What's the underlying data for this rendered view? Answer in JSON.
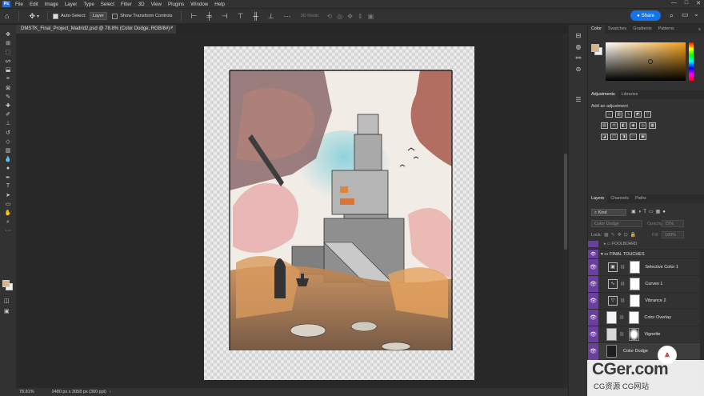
{
  "app": {
    "logo": "Ps",
    "menu": [
      "File",
      "Edit",
      "Image",
      "Layer",
      "Type",
      "Select",
      "Filter",
      "3D",
      "View",
      "Plugins",
      "Window",
      "Help"
    ],
    "window_controls": [
      "—",
      "□",
      "✕"
    ]
  },
  "options_bar": {
    "auto_select_label": "Auto-Select:",
    "auto_select_value": "Layer",
    "show_transform_label": "Show Transform Controls",
    "mode_3d_label": "3D Mode:",
    "share_label": "Share"
  },
  "document": {
    "tab_title": "DMSTK_Final_Project_Madrid2.psd @ 78.8% (Color Dodge, RGB/8#) *",
    "close_glyph": "×"
  },
  "status_bar": {
    "zoom": "78.81%",
    "doc_info": "2480 px x 3058 px (300 ppi)",
    "arrow": "›"
  },
  "color_panel": {
    "tabs": [
      "Color",
      "Swatches",
      "Gradients",
      "Patterns"
    ],
    "active_tab": "Color",
    "foreground": "#d9b488",
    "background": "#f2efe9",
    "hue": "#f6a21a"
  },
  "adjustments_panel": {
    "tabs": [
      "Adjustments",
      "Libraries"
    ],
    "active_tab": "Adjustments",
    "add_label": "Add an adjustment"
  },
  "layers_panel": {
    "tabs": [
      "Layers",
      "Channels",
      "Paths"
    ],
    "active_tab": "Layers",
    "filter_kind": "Kind",
    "blend_mode": "Color Dodge",
    "opacity_label": "Opacity:",
    "opacity_value": "72%",
    "lock_label": "Lock:",
    "fill_label": "Fill:",
    "fill_value": "100%",
    "group_top": "FOOLBOARD",
    "group": "FINAL TOUCHES",
    "layers": [
      {
        "name": "Selective Color 1",
        "icon": "selective-color-icon"
      },
      {
        "name": "Curves 1",
        "icon": "curves-icon"
      },
      {
        "name": "Vibrance 2",
        "icon": "vibrance-icon"
      },
      {
        "name": "Color Overlay",
        "icon": "image-thumb"
      },
      {
        "name": "Vignette",
        "icon": "image-thumb"
      },
      {
        "name": "Color Dodge",
        "icon": "image-thumb"
      }
    ]
  },
  "watermark": {
    "title": "CGer.com",
    "subtitle": "CG资源 CG网站"
  }
}
